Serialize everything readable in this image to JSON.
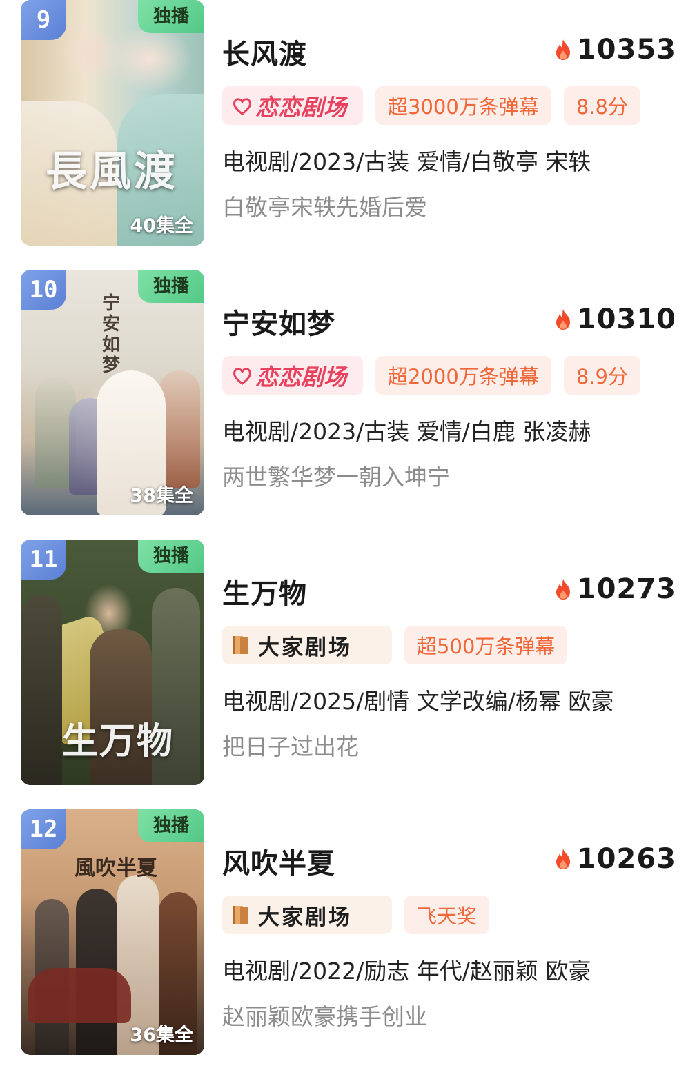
{
  "items": [
    {
      "rank": "9",
      "exclusive": "独播",
      "episodes": "40集全",
      "poster_title": "長風渡",
      "title": "长风渡",
      "heat": "10353",
      "brand": "恋恋剧场",
      "tags": [
        "超3000万条弹幕",
        "8.8分"
      ],
      "meta": "电视剧/2023/古装 爱情/白敬亭 宋轶",
      "desc": "白敬亭宋轶先婚后爱"
    },
    {
      "rank": "10",
      "exclusive": "独播",
      "episodes": "38集全",
      "poster_title": "宁安如梦",
      "title": "宁安如梦",
      "heat": "10310",
      "brand": "恋恋剧场",
      "tags": [
        "超2000万条弹幕",
        "8.9分"
      ],
      "meta": "电视剧/2023/古装 爱情/白鹿 张凌赫",
      "desc": "两世繁华梦一朝入坤宁"
    },
    {
      "rank": "11",
      "exclusive": "独播",
      "episodes": "",
      "poster_title": "生万物",
      "title": "生万物",
      "heat": "10273",
      "brand": "大家剧场",
      "tags": [
        "超500万条弹幕"
      ],
      "meta": "电视剧/2025/剧情 文学改编/杨幂 欧豪",
      "desc": "把日子过出花"
    },
    {
      "rank": "12",
      "exclusive": "独播",
      "episodes": "36集全",
      "poster_title": "風吹半夏",
      "title": "风吹半夏",
      "heat": "10263",
      "brand": "大家剧场",
      "tags": [
        "飞天奖"
      ],
      "meta": "电视剧/2022/励志 年代/赵丽颖 欧豪",
      "desc": "赵丽颖欧豪携手创业"
    }
  ],
  "colors": {
    "rank_badge": "#6b8fdf",
    "exclusive_badge": "#5dd392",
    "tag_text": "#f0683a",
    "tag_bg": "#fdeeea",
    "lianlian_brand": "#e8415e",
    "flame": "#f24a2b",
    "desc_text": "#8c8c8c"
  },
  "icons": {
    "heat": "flame-icon",
    "dajia_logo": "book-icon"
  }
}
